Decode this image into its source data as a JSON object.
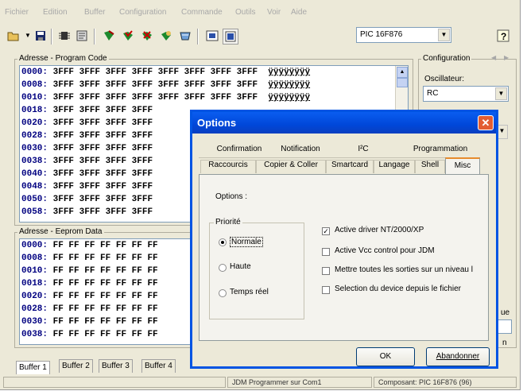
{
  "menu": [
    "Fichier",
    "Edition",
    "Buffer",
    "Configuration",
    "Commande",
    "Outils",
    "Voir",
    "Aide"
  ],
  "toolbar": {
    "icons": [
      "open-icon",
      "dropdown-icon",
      "save-icon",
      "chip-icon",
      "properties-icon",
      "program-icon",
      "verify-icon",
      "erase-icon",
      "blank-check-icon",
      "read-icon",
      "device-icon",
      "buffer-icon",
      "help-icon"
    ],
    "device": "PIC 16F876"
  },
  "program": {
    "label": "Adresse - Program Code",
    "rows": [
      {
        "addr": "0000:",
        "data": "3FFF 3FFF 3FFF 3FFF 3FFF 3FFF 3FFF 3FFF",
        "ascii": "ÿÿÿÿÿÿÿÿ"
      },
      {
        "addr": "0008:",
        "data": "3FFF 3FFF 3FFF 3FFF 3FFF 3FFF 3FFF 3FFF",
        "ascii": "ÿÿÿÿÿÿÿÿ"
      },
      {
        "addr": "0010:",
        "data": "3FFF 3FFF 3FFF 3FFF 3FFF 3FFF 3FFF 3FFF",
        "ascii": "ÿÿÿÿÿÿÿÿ"
      },
      {
        "addr": "0018:",
        "data": "3FFF 3FFF 3FFF 3FFF",
        "ascii": ""
      },
      {
        "addr": "0020:",
        "data": "3FFF 3FFF 3FFF 3FFF",
        "ascii": ""
      },
      {
        "addr": "0028:",
        "data": "3FFF 3FFF 3FFF 3FFF",
        "ascii": ""
      },
      {
        "addr": "0030:",
        "data": "3FFF 3FFF 3FFF 3FFF",
        "ascii": ""
      },
      {
        "addr": "0038:",
        "data": "3FFF 3FFF 3FFF 3FFF",
        "ascii": ""
      },
      {
        "addr": "0040:",
        "data": "3FFF 3FFF 3FFF 3FFF",
        "ascii": ""
      },
      {
        "addr": "0048:",
        "data": "3FFF 3FFF 3FFF 3FFF",
        "ascii": ""
      },
      {
        "addr": "0050:",
        "data": "3FFF 3FFF 3FFF 3FFF",
        "ascii": ""
      },
      {
        "addr": "0058:",
        "data": "3FFF 3FFF 3FFF 3FFF",
        "ascii": ""
      }
    ]
  },
  "eeprom": {
    "label": "Adresse - Eeprom Data",
    "rows": [
      {
        "addr": "0000:",
        "data": "FF FF FF FF FF FF FF"
      },
      {
        "addr": "0008:",
        "data": "FF FF FF FF FF FF FF"
      },
      {
        "addr": "0010:",
        "data": "FF FF FF FF FF FF FF"
      },
      {
        "addr": "0018:",
        "data": "FF FF FF FF FF FF FF"
      },
      {
        "addr": "0020:",
        "data": "FF FF FF FF FF FF FF"
      },
      {
        "addr": "0028:",
        "data": "FF FF FF FF FF FF FF"
      },
      {
        "addr": "0030:",
        "data": "FF FF FF FF FF FF FF"
      },
      {
        "addr": "0038:",
        "data": "FF FF FF FF FF FF FF"
      }
    ]
  },
  "config": {
    "label": "Configuration",
    "osc_label": "Oscillateur:",
    "osc_value": "RC",
    "partial_right_1": "ue",
    "partial_right_2": "n"
  },
  "buffers": [
    "Buffer 1",
    "Buffer 2",
    "Buffer 3",
    "Buffer 4"
  ],
  "status": {
    "programmer": "JDM Programmer sur Com1",
    "component": "Composant: PIC 16F876 (96)"
  },
  "dialog": {
    "title": "Options",
    "tabs_row1": [
      "Confirmation",
      "Notification",
      "I²C",
      "Programmation"
    ],
    "tabs_row2": [
      "Raccourcis",
      "Copier & Coller",
      "Smartcard",
      "Langage",
      "Shell",
      "Misc"
    ],
    "active_tab": "Misc",
    "options_label": "Options :",
    "priority_label": "Priorité",
    "priorities": [
      "Normale",
      "Haute",
      "Temps réel"
    ],
    "selected_priority": "Normale",
    "checks": [
      {
        "label": "Active driver NT/2000/XP",
        "checked": true
      },
      {
        "label": "Active Vcc control pour JDM",
        "checked": false
      },
      {
        "label": "Mettre toutes les sorties sur un niveau l",
        "checked": false
      },
      {
        "label": "Selection du device depuis le fichier",
        "checked": false
      }
    ],
    "ok": "OK",
    "cancel": "Abandonner"
  }
}
